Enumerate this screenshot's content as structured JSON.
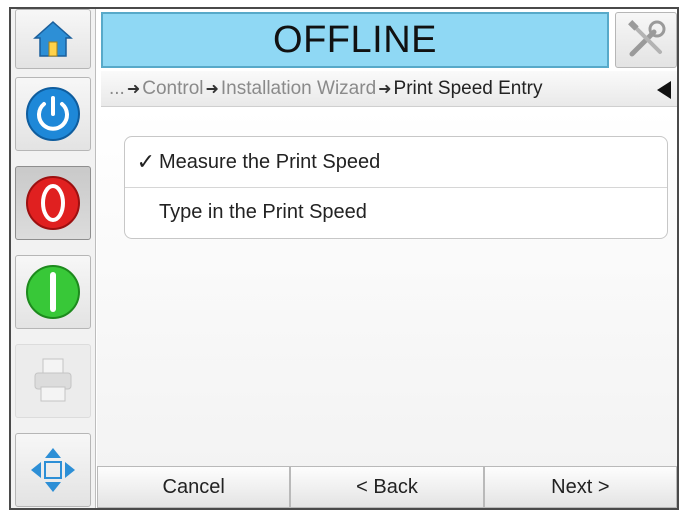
{
  "header": {
    "status": "OFFLINE"
  },
  "sidebar": {
    "icons": [
      "home-icon",
      "power-icon",
      "stop-icon",
      "start-icon",
      "printer-icon",
      "navigate-icon"
    ]
  },
  "breadcrumb": {
    "ellipsis": "...",
    "items": [
      "Control",
      "Installation Wizard",
      "Print Speed Entry"
    ]
  },
  "options": [
    {
      "label": "Measure the Print Speed",
      "selected": true,
      "check": "✓"
    },
    {
      "label": "Type in the Print Speed",
      "selected": false,
      "check": ""
    }
  ],
  "footer": {
    "cancel": "Cancel",
    "back": "< Back",
    "next": "Next >"
  },
  "colors": {
    "status_bg": "#8fd8f4",
    "power_blue": "#1e88d8",
    "stop_red": "#e02020",
    "start_green": "#38c838"
  }
}
